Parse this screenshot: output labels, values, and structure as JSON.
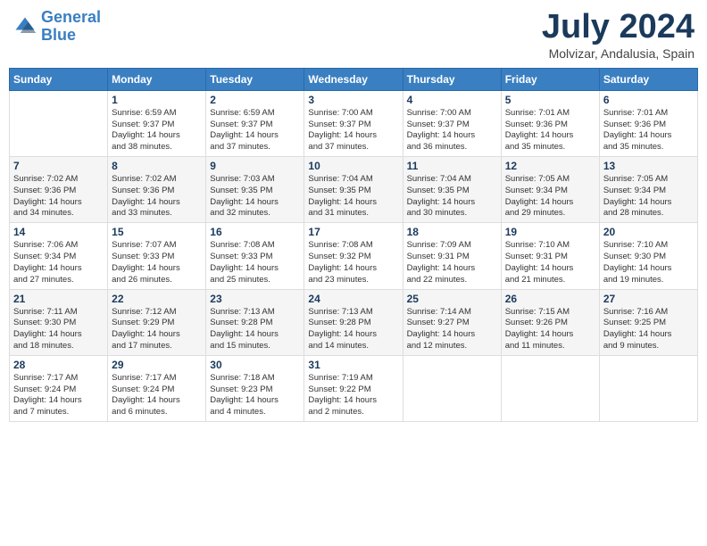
{
  "header": {
    "logo_line1": "General",
    "logo_line2": "Blue",
    "month": "July 2024",
    "location": "Molvizar, Andalusia, Spain"
  },
  "weekdays": [
    "Sunday",
    "Monday",
    "Tuesday",
    "Wednesday",
    "Thursday",
    "Friday",
    "Saturday"
  ],
  "weeks": [
    [
      {
        "day": "",
        "info": ""
      },
      {
        "day": "1",
        "info": "Sunrise: 6:59 AM\nSunset: 9:37 PM\nDaylight: 14 hours\nand 38 minutes."
      },
      {
        "day": "2",
        "info": "Sunrise: 6:59 AM\nSunset: 9:37 PM\nDaylight: 14 hours\nand 37 minutes."
      },
      {
        "day": "3",
        "info": "Sunrise: 7:00 AM\nSunset: 9:37 PM\nDaylight: 14 hours\nand 37 minutes."
      },
      {
        "day": "4",
        "info": "Sunrise: 7:00 AM\nSunset: 9:37 PM\nDaylight: 14 hours\nand 36 minutes."
      },
      {
        "day": "5",
        "info": "Sunrise: 7:01 AM\nSunset: 9:36 PM\nDaylight: 14 hours\nand 35 minutes."
      },
      {
        "day": "6",
        "info": "Sunrise: 7:01 AM\nSunset: 9:36 PM\nDaylight: 14 hours\nand 35 minutes."
      }
    ],
    [
      {
        "day": "7",
        "info": "Sunrise: 7:02 AM\nSunset: 9:36 PM\nDaylight: 14 hours\nand 34 minutes."
      },
      {
        "day": "8",
        "info": "Sunrise: 7:02 AM\nSunset: 9:36 PM\nDaylight: 14 hours\nand 33 minutes."
      },
      {
        "day": "9",
        "info": "Sunrise: 7:03 AM\nSunset: 9:35 PM\nDaylight: 14 hours\nand 32 minutes."
      },
      {
        "day": "10",
        "info": "Sunrise: 7:04 AM\nSunset: 9:35 PM\nDaylight: 14 hours\nand 31 minutes."
      },
      {
        "day": "11",
        "info": "Sunrise: 7:04 AM\nSunset: 9:35 PM\nDaylight: 14 hours\nand 30 minutes."
      },
      {
        "day": "12",
        "info": "Sunrise: 7:05 AM\nSunset: 9:34 PM\nDaylight: 14 hours\nand 29 minutes."
      },
      {
        "day": "13",
        "info": "Sunrise: 7:05 AM\nSunset: 9:34 PM\nDaylight: 14 hours\nand 28 minutes."
      }
    ],
    [
      {
        "day": "14",
        "info": "Sunrise: 7:06 AM\nSunset: 9:34 PM\nDaylight: 14 hours\nand 27 minutes."
      },
      {
        "day": "15",
        "info": "Sunrise: 7:07 AM\nSunset: 9:33 PM\nDaylight: 14 hours\nand 26 minutes."
      },
      {
        "day": "16",
        "info": "Sunrise: 7:08 AM\nSunset: 9:33 PM\nDaylight: 14 hours\nand 25 minutes."
      },
      {
        "day": "17",
        "info": "Sunrise: 7:08 AM\nSunset: 9:32 PM\nDaylight: 14 hours\nand 23 minutes."
      },
      {
        "day": "18",
        "info": "Sunrise: 7:09 AM\nSunset: 9:31 PM\nDaylight: 14 hours\nand 22 minutes."
      },
      {
        "day": "19",
        "info": "Sunrise: 7:10 AM\nSunset: 9:31 PM\nDaylight: 14 hours\nand 21 minutes."
      },
      {
        "day": "20",
        "info": "Sunrise: 7:10 AM\nSunset: 9:30 PM\nDaylight: 14 hours\nand 19 minutes."
      }
    ],
    [
      {
        "day": "21",
        "info": "Sunrise: 7:11 AM\nSunset: 9:30 PM\nDaylight: 14 hours\nand 18 minutes."
      },
      {
        "day": "22",
        "info": "Sunrise: 7:12 AM\nSunset: 9:29 PM\nDaylight: 14 hours\nand 17 minutes."
      },
      {
        "day": "23",
        "info": "Sunrise: 7:13 AM\nSunset: 9:28 PM\nDaylight: 14 hours\nand 15 minutes."
      },
      {
        "day": "24",
        "info": "Sunrise: 7:13 AM\nSunset: 9:28 PM\nDaylight: 14 hours\nand 14 minutes."
      },
      {
        "day": "25",
        "info": "Sunrise: 7:14 AM\nSunset: 9:27 PM\nDaylight: 14 hours\nand 12 minutes."
      },
      {
        "day": "26",
        "info": "Sunrise: 7:15 AM\nSunset: 9:26 PM\nDaylight: 14 hours\nand 11 minutes."
      },
      {
        "day": "27",
        "info": "Sunrise: 7:16 AM\nSunset: 9:25 PM\nDaylight: 14 hours\nand 9 minutes."
      }
    ],
    [
      {
        "day": "28",
        "info": "Sunrise: 7:17 AM\nSunset: 9:24 PM\nDaylight: 14 hours\nand 7 minutes."
      },
      {
        "day": "29",
        "info": "Sunrise: 7:17 AM\nSunset: 9:24 PM\nDaylight: 14 hours\nand 6 minutes."
      },
      {
        "day": "30",
        "info": "Sunrise: 7:18 AM\nSunset: 9:23 PM\nDaylight: 14 hours\nand 4 minutes."
      },
      {
        "day": "31",
        "info": "Sunrise: 7:19 AM\nSunset: 9:22 PM\nDaylight: 14 hours\nand 2 minutes."
      },
      {
        "day": "",
        "info": ""
      },
      {
        "day": "",
        "info": ""
      },
      {
        "day": "",
        "info": ""
      }
    ]
  ]
}
